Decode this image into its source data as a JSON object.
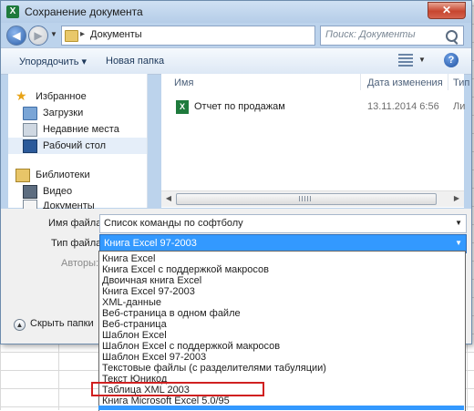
{
  "window": {
    "title": "Сохранение документа",
    "close_glyph": "✕"
  },
  "nav": {
    "breadcrumb_sep": "▸",
    "breadcrumb": "Документы",
    "search_placeholder": "Поиск: Документы"
  },
  "toolbar": {
    "organize": "Упорядочить ▾",
    "new_folder": "Новая папка"
  },
  "sidebar": {
    "items": [
      {
        "label": "Избранное",
        "icon": "star-icon"
      },
      {
        "label": "Загрузки",
        "icon": "downloads-icon"
      },
      {
        "label": "Недавние места",
        "icon": "recent-places-icon"
      },
      {
        "label": "Рабочий стол",
        "icon": "desktop-icon"
      },
      {
        "label": "Библиотеки",
        "icon": "libraries-icon"
      },
      {
        "label": "Видео",
        "icon": "video-icon"
      },
      {
        "label": "Документы",
        "icon": "documents-icon"
      }
    ]
  },
  "files": {
    "columns": [
      "Имя",
      "Дата изменения",
      "Тип"
    ],
    "rows": [
      {
        "name": "Отчет по продажам",
        "date": "13.11.2014 6:56",
        "type": "Ли"
      }
    ]
  },
  "form": {
    "filename_label": "Имя файла:",
    "filename_value": "Список команды по софтболу",
    "filetype_label": "Тип файла:",
    "filetype_value": "Книга Excel 97-2003",
    "authors_label": "Авторы:",
    "hide_folders": "Скрыть папки"
  },
  "filetype_options": [
    "Книга Excel",
    "Книга Excel с поддержкой макросов",
    "Двоичная книга Excel",
    "Книга Excel 97-2003",
    "XML-данные",
    "Веб-страница в одном файле",
    "Веб-страница",
    "Шаблон Excel",
    "Шаблон Excel с поддержкой макросов",
    "Шаблон Excel 97-2003",
    "Текстовые файлы (с разделителями табуляции)",
    "Текст Юникод",
    "Таблица XML 2003",
    "Книга Microsoft Excel 5.0/95"
  ],
  "highlighted_option": "Таблица XML 2003",
  "colors": {
    "accent": "#3399ff",
    "highlight_border": "#d02020",
    "excel_green": "#1e7a3c"
  }
}
